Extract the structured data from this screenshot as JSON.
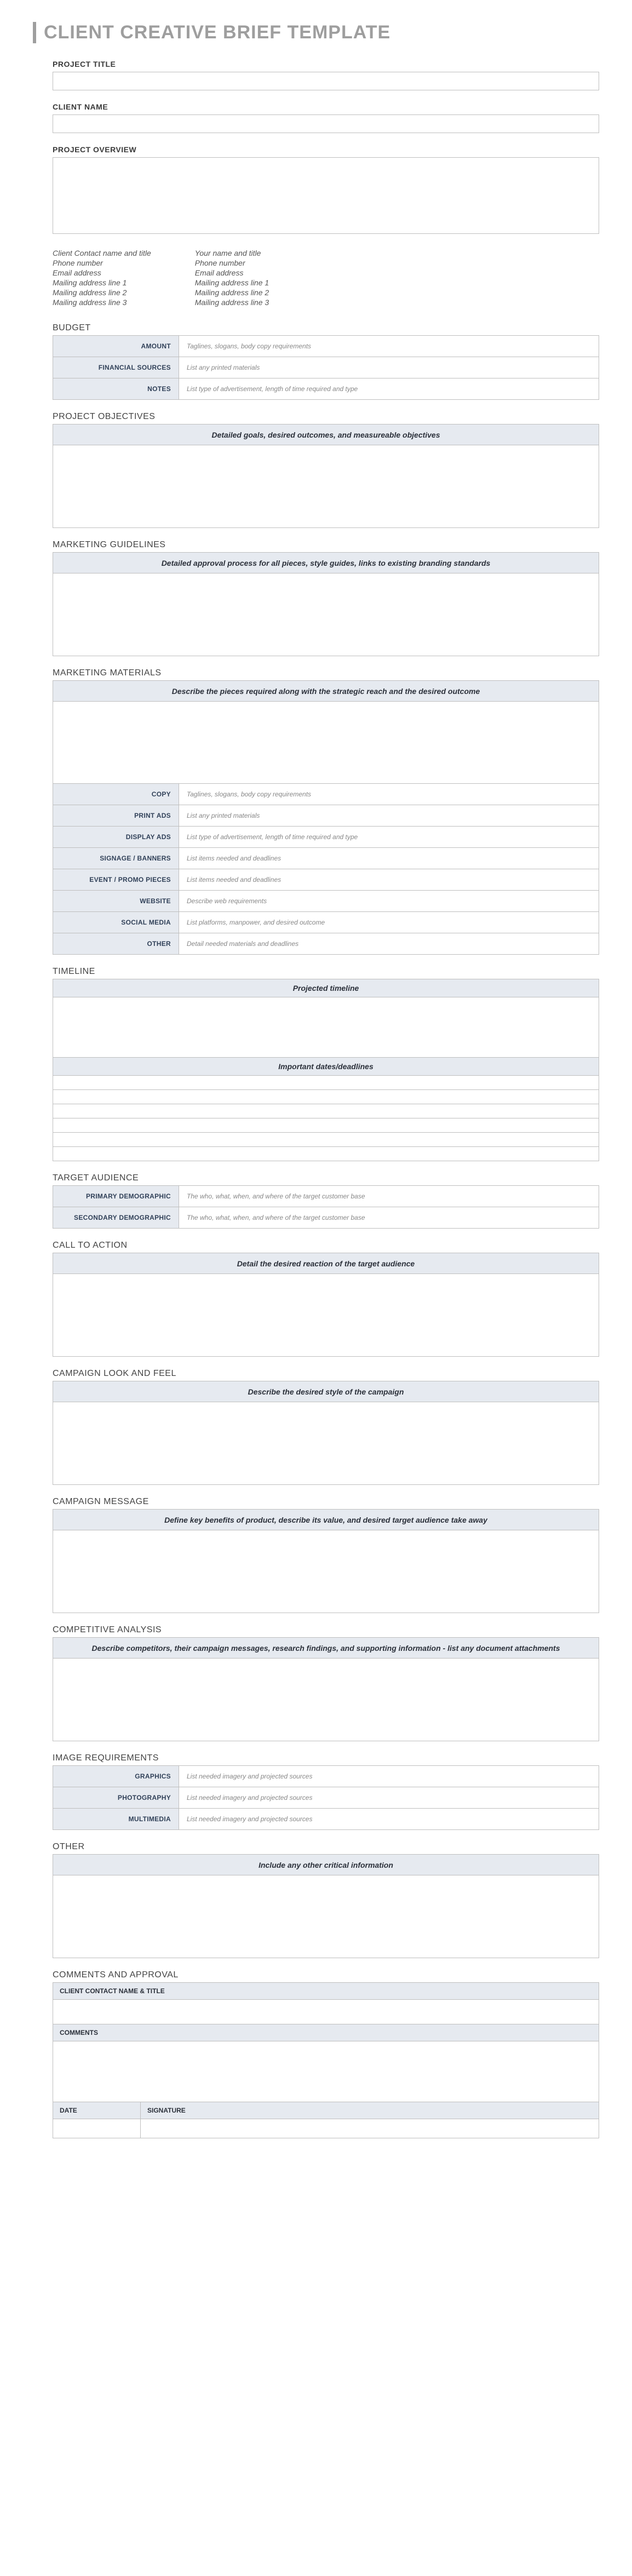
{
  "title": "CLIENT CREATIVE BRIEF TEMPLATE",
  "fields": {
    "project_title": "PROJECT TITLE",
    "client_name": "CLIENT NAME",
    "project_overview": "PROJECT OVERVIEW"
  },
  "contacts": {
    "client": [
      "Client Contact name and title",
      "Phone number",
      "Email address",
      "Mailing address line 1",
      "Mailing address line 2",
      "Mailing address line 3"
    ],
    "you": [
      "Your name and title",
      "Phone number",
      "Email address",
      "Mailing address line 1",
      "Mailing address line 2",
      "Mailing address line 3"
    ]
  },
  "budget": {
    "heading": "BUDGET",
    "rows": [
      {
        "label": "AMOUNT",
        "value": "Taglines, slogans, body copy requirements"
      },
      {
        "label": "FINANCIAL SOURCES",
        "value": "List any printed materials"
      },
      {
        "label": "NOTES",
        "value": "List type of advertisement, length of time required and type"
      }
    ]
  },
  "objectives": {
    "heading": "PROJECT OBJECTIVES",
    "subhead": "Detailed goals, desired outcomes, and measureable objectives"
  },
  "guidelines": {
    "heading": "MARKETING GUIDELINES",
    "subhead": "Detailed approval process for all pieces, style guides, links to existing branding standards"
  },
  "materials": {
    "heading": "MARKETING MATERIALS",
    "subhead": "Describe the pieces required along with the strategic reach and the desired outcome",
    "rows": [
      {
        "label": "COPY",
        "value": "Taglines, slogans, body copy requirements"
      },
      {
        "label": "PRINT ADS",
        "value": "List any printed materials"
      },
      {
        "label": "DISPLAY ADS",
        "value": "List type of advertisement, length of time required and type"
      },
      {
        "label": "SIGNAGE / BANNERS",
        "value": "List items needed and deadlines"
      },
      {
        "label": "EVENT / PROMO PIECES",
        "value": "List items needed and deadlines"
      },
      {
        "label": "WEBSITE",
        "value": "Describe web requirements"
      },
      {
        "label": "SOCIAL MEDIA",
        "value": "List platforms, manpower, and desired outcome"
      },
      {
        "label": "OTHER",
        "value": "Detail needed materials and deadlines"
      }
    ]
  },
  "timeline": {
    "heading": "TIMELINE",
    "projected": "Projected timeline",
    "important": "Important dates/deadlines"
  },
  "audience": {
    "heading": "TARGET AUDIENCE",
    "rows": [
      {
        "label": "PRIMARY DEMOGRAPHIC",
        "value": "The who, what, when, and where of the target customer base"
      },
      {
        "label": "SECONDARY DEMOGRAPHIC",
        "value": "The who, what, when, and where of the target customer base"
      }
    ]
  },
  "cta": {
    "heading": "CALL TO ACTION",
    "subhead": "Detail the desired reaction of the target audience"
  },
  "look": {
    "heading": "CAMPAIGN LOOK AND FEEL",
    "subhead": "Describe the desired style of the campaign"
  },
  "message": {
    "heading": "CAMPAIGN MESSAGE",
    "subhead": "Define key benefits of product, describe its value, and desired target audience take away"
  },
  "competitive": {
    "heading": "COMPETITIVE ANALYSIS",
    "subhead": "Describe competitors, their campaign messages, research findings, and supporting information - list any document attachments"
  },
  "image_req": {
    "heading": "IMAGE REQUIREMENTS",
    "rows": [
      {
        "label": "GRAPHICS",
        "value": "List needed imagery and projected sources"
      },
      {
        "label": "PHOTOGRAPHY",
        "value": "List needed imagery and projected sources"
      },
      {
        "label": "MULTIMEDIA",
        "value": "List needed imagery and projected sources"
      }
    ]
  },
  "other": {
    "heading": "OTHER",
    "subhead": "Include any other critical information"
  },
  "approval": {
    "heading": "COMMENTS AND APPROVAL",
    "contact": "CLIENT CONTACT NAME & TITLE",
    "comments": "COMMENTS",
    "date": "DATE",
    "signature": "SIGNATURE"
  }
}
